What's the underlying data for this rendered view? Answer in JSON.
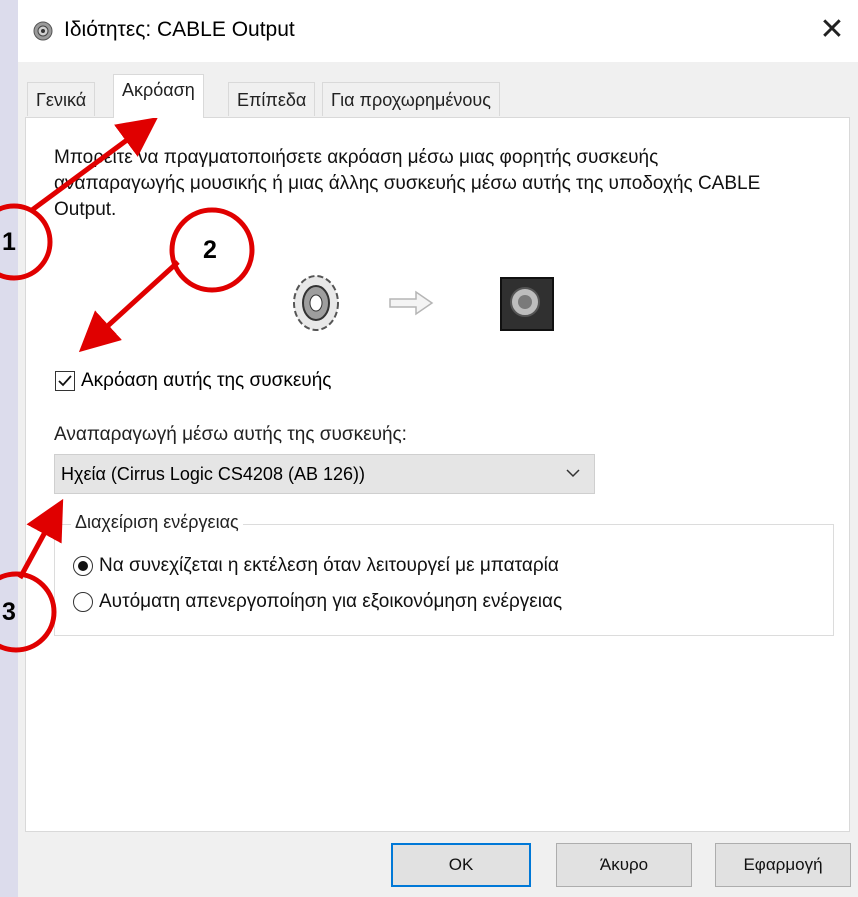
{
  "window": {
    "title": "Ιδιότητες: CABLE Output",
    "close_symbol": "✕",
    "icon": "speaker-properties-icon"
  },
  "tabs": [
    {
      "label": "Γενικά",
      "active": false
    },
    {
      "label": "Ακρόαση",
      "active": true
    },
    {
      "label": "Επίπεδα",
      "active": false
    },
    {
      "label": "Για προχωρημένους",
      "active": false
    }
  ],
  "listen": {
    "description": "Μπορείτε να πραγματοποιήσετε ακρόαση μέσω μιας φορητής συσκευής αναπαραγωγής μουσικής ή μιας άλλης συσκευής μέσω αυτής της υποδοχής CABLE Output.",
    "checkbox_label": "Ακρόαση αυτής της συσκευής",
    "checkbox_checked": true,
    "playback_label": "Αναπαραγωγή μέσω αυτής της συσκευής:",
    "playback_device": "Ηχεία (Cirrus Logic CS4208 (AB 126))"
  },
  "power": {
    "group_label": "Διαχείριση ενέργειας",
    "options": [
      {
        "label": "Να συνεχίζεται η εκτέλεση όταν λειτουργεί με μπαταρία",
        "selected": true
      },
      {
        "label": "Αυτόματη απενεργοποίηση για εξοικονόμηση ενέργειας",
        "selected": false
      }
    ]
  },
  "buttons": {
    "ok": "OK",
    "cancel": "Άκυρο",
    "apply": "Εφαρμογή"
  },
  "annotations": [
    "1",
    "2",
    "3"
  ],
  "colors": {
    "annotation": "#e00000",
    "accent": "#0078d7"
  }
}
